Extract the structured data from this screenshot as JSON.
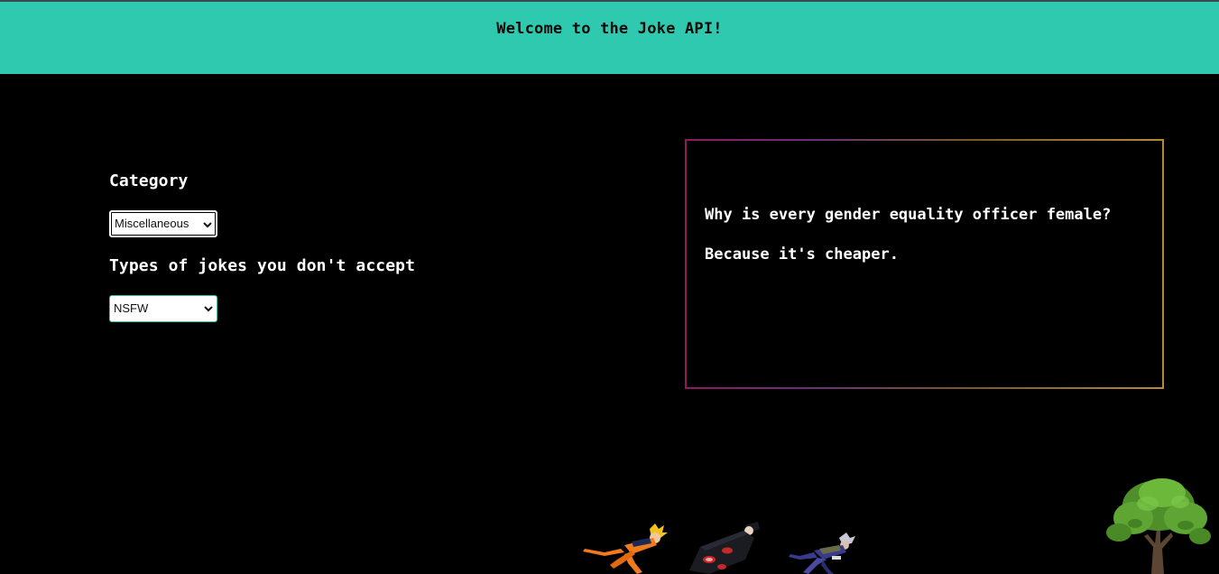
{
  "header": {
    "title": "Welcome to the Joke API!"
  },
  "form": {
    "category_label": "Category",
    "category_selected": "Miscellaneous",
    "types_label": "Types of jokes you don't accept",
    "types_selected": "NSFW"
  },
  "joke": {
    "setup": "Why is every gender equality officer female?",
    "delivery": "Because it's cheaper."
  },
  "colors": {
    "header_bg": "#2ec9ae",
    "page_bg": "#000000",
    "text": "#ffffff"
  },
  "icons": {
    "select_arrow": "chevron-down-icon",
    "runner_1": "orange-ninja-running-image",
    "runner_2": "cloaked-ninja-running-image",
    "runner_3": "purple-ninja-running-image",
    "tree": "tree-image"
  }
}
